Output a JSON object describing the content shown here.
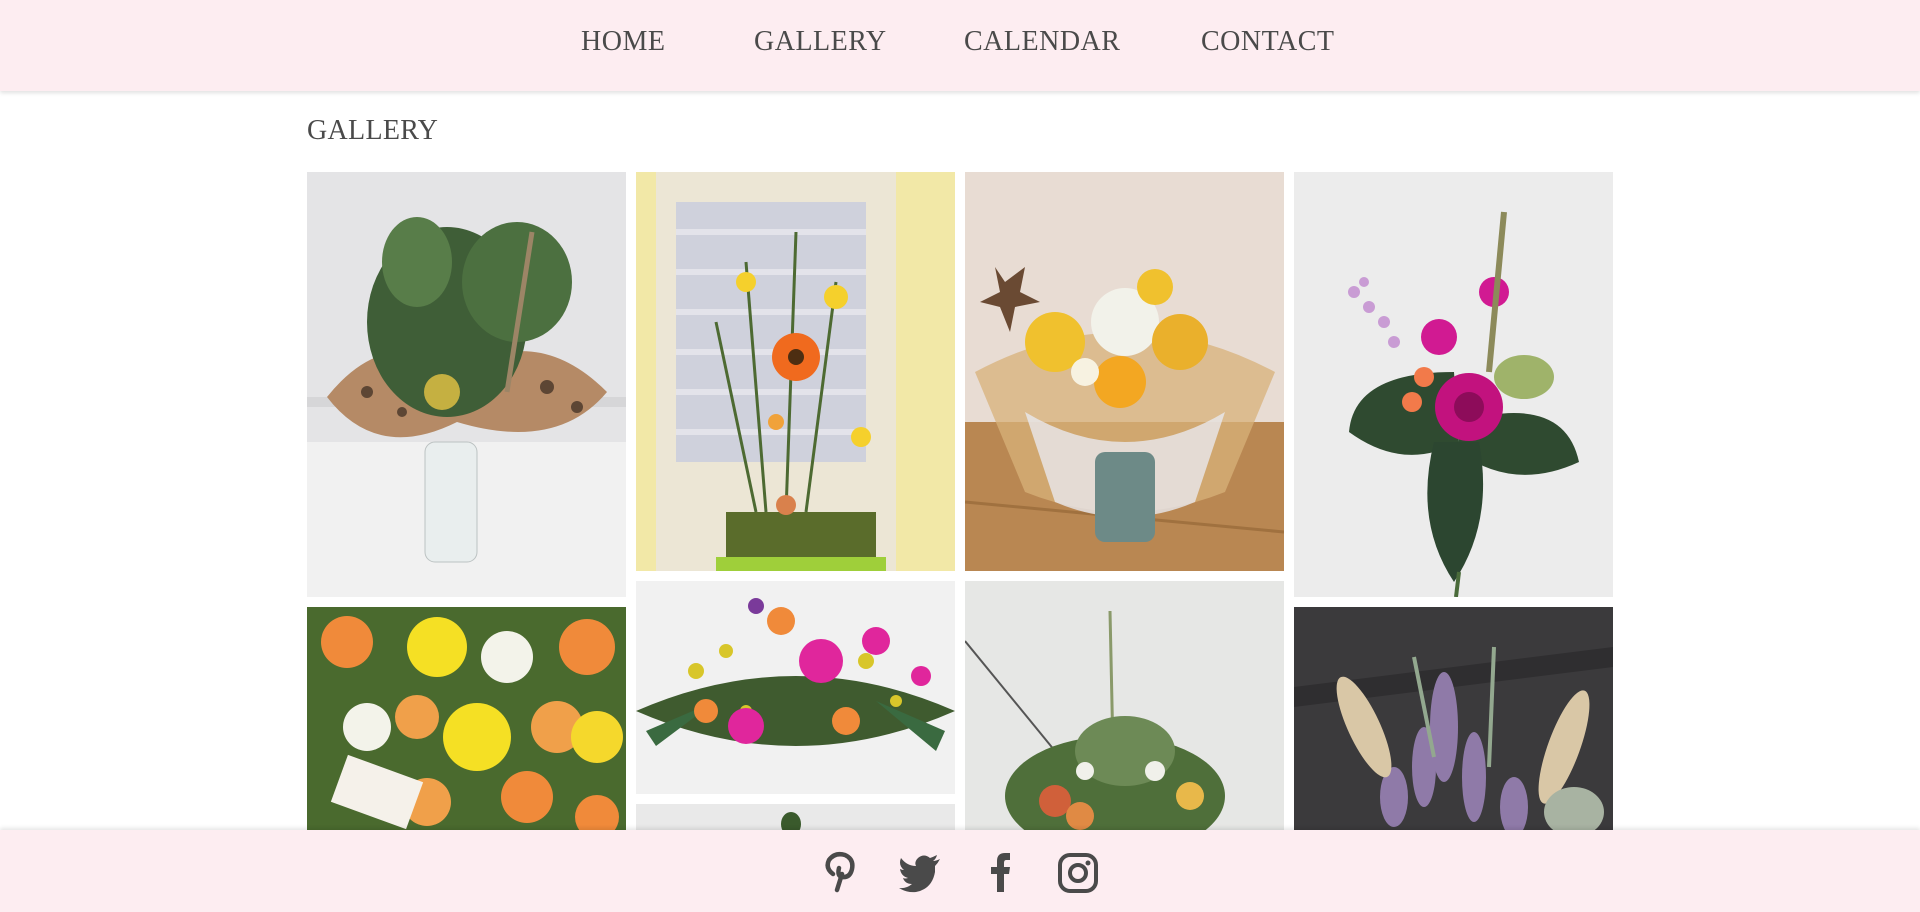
{
  "nav": {
    "items": [
      {
        "label": "HOME"
      },
      {
        "label": "GALLERY"
      },
      {
        "label": "CALENDAR"
      },
      {
        "label": "CONTACT"
      }
    ]
  },
  "page": {
    "title": "GALLERY"
  },
  "gallery": {
    "images": [
      {
        "name": "gallery-image-vase-bouquet-polka-dot-ribbon"
      },
      {
        "name": "gallery-image-upright-arrangement-gerbera"
      },
      {
        "name": "gallery-image-wrapped-hand-tied-bouquet"
      },
      {
        "name": "gallery-image-pink-rose-corsage-spray"
      },
      {
        "name": "gallery-image-yellow-rose-arrangement"
      },
      {
        "name": "gallery-image-long-table-arrangement"
      },
      {
        "name": "gallery-image-partial"
      },
      {
        "name": "gallery-image-green-arrangement"
      },
      {
        "name": "gallery-image-pampas-lavender-arrangement"
      }
    ]
  },
  "footer": {
    "social": [
      {
        "icon": "pinterest-icon"
      },
      {
        "icon": "twitter-icon"
      },
      {
        "icon": "facebook-icon"
      },
      {
        "icon": "instagram-icon"
      }
    ]
  },
  "colors": {
    "bar_background": "#fdedf1",
    "text": "#4a4a4a",
    "icon": "#4a4a4a"
  }
}
